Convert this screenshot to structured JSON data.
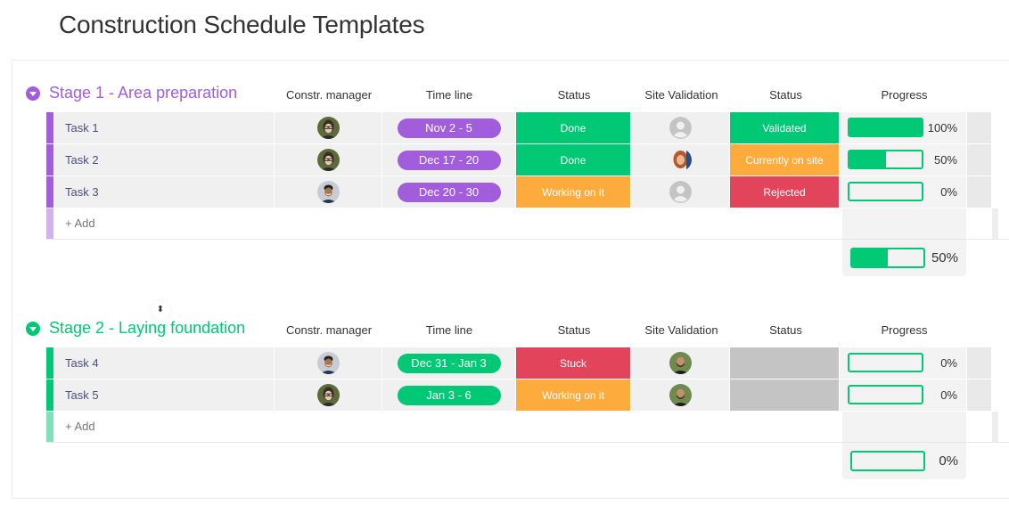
{
  "page": {
    "title": "Construction Schedule Templates"
  },
  "columns": {
    "manager": "Constr. manager",
    "timeline": "Time line",
    "status": "Status",
    "site_validation": "Site Validation",
    "validation_status": "Status",
    "progress": "Progress"
  },
  "colors": {
    "purple": "#a25ddc",
    "purple_light": "#d2b1ee",
    "green": "#00c875",
    "green_light": "#7fe3ba",
    "orange": "#fdab3d",
    "red": "#e2445c",
    "gray": "#c4c4c4"
  },
  "groups": [
    {
      "title": "Stage 1 - Area preparation",
      "color": "#a25ddc",
      "add_label": "+ Add",
      "summary_progress": 50,
      "summary_progress_label": "50%",
      "tasks": [
        {
          "name": "Task 1",
          "manager": "woman-glasses",
          "timeline": "Nov 2 - 5",
          "status": "Done",
          "status_color": "#00c875",
          "site_validation": "placeholder",
          "validation_status": "Validated",
          "validation_color": "#00c875",
          "progress": 100,
          "progress_label": "100%"
        },
        {
          "name": "Task 2",
          "manager": "woman-glasses",
          "timeline": "Dec 17 - 20",
          "status": "Done",
          "status_color": "#00c875",
          "site_validation": "woman-red-hair",
          "validation_status": "Currently on site",
          "validation_color": "#fdab3d",
          "progress": 50,
          "progress_label": "50%"
        },
        {
          "name": "Task 3",
          "manager": "man-smiling",
          "timeline": "Dec 20 - 30",
          "status": "Working on it",
          "status_color": "#fdab3d",
          "site_validation": "placeholder",
          "validation_status": "Rejected",
          "validation_color": "#e2445c",
          "progress": 0,
          "progress_label": "0%"
        }
      ]
    },
    {
      "title": "Stage 2 - Laying foundation",
      "color": "#00c875",
      "add_label": "+ Add",
      "summary_progress": 0,
      "summary_progress_label": "0%",
      "tasks": [
        {
          "name": "Task 4",
          "manager": "man-smiling",
          "timeline": "Dec 31 - Jan 3",
          "status": "Stuck",
          "status_color": "#e2445c",
          "site_validation": "man-beard",
          "validation_status": "",
          "validation_color": "#c4c4c4",
          "progress": 0,
          "progress_label": "0%"
        },
        {
          "name": "Task 5",
          "manager": "woman-glasses",
          "timeline": "Jan 3 - 6",
          "status": "Working on it",
          "status_color": "#fdab3d",
          "site_validation": "man-beard",
          "validation_status": "",
          "validation_color": "#c4c4c4",
          "progress": 0,
          "progress_label": "0%"
        }
      ]
    }
  ]
}
